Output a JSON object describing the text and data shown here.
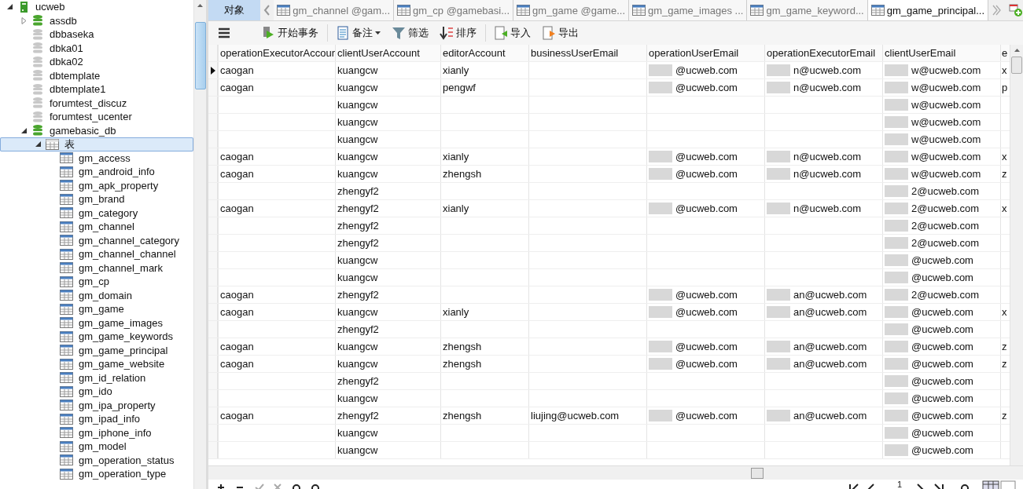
{
  "sidebar": {
    "tree": [
      {
        "label": "ucweb",
        "kind": "connection",
        "selected": false,
        "expanded": true,
        "children": [
          {
            "label": "assdb",
            "kind": "database",
            "open": true,
            "selected": false,
            "expanded": false
          },
          {
            "label": "dbbaseka",
            "kind": "database",
            "open": false,
            "selected": false
          },
          {
            "label": "dbka01",
            "kind": "database",
            "open": false,
            "selected": false
          },
          {
            "label": "dbka02",
            "kind": "database",
            "open": false,
            "selected": false
          },
          {
            "label": "dbtemplate",
            "kind": "database",
            "open": false,
            "selected": false
          },
          {
            "label": "dbtemplate1",
            "kind": "database",
            "open": false,
            "selected": false
          },
          {
            "label": "forumtest_discuz",
            "kind": "database",
            "open": false,
            "selected": false
          },
          {
            "label": "forumtest_ucenter",
            "kind": "database",
            "open": false,
            "selected": false
          },
          {
            "label": "gamebasic_db",
            "kind": "database",
            "open": true,
            "selected": false,
            "expanded": true,
            "children": [
              {
                "label": "表",
                "kind": "folder",
                "selected": true,
                "expanded": true,
                "children": [
                  {
                    "label": "gm_access",
                    "kind": "table",
                    "selected": false
                  },
                  {
                    "label": "gm_android_info",
                    "kind": "table",
                    "selected": false
                  },
                  {
                    "label": "gm_apk_property",
                    "kind": "table",
                    "selected": false
                  },
                  {
                    "label": "gm_brand",
                    "kind": "table",
                    "selected": false
                  },
                  {
                    "label": "gm_category",
                    "kind": "table",
                    "selected": false
                  },
                  {
                    "label": "gm_channel",
                    "kind": "table",
                    "selected": false
                  },
                  {
                    "label": "gm_channel_category",
                    "kind": "table",
                    "selected": false
                  },
                  {
                    "label": "gm_channel_channel",
                    "kind": "table",
                    "selected": false
                  },
                  {
                    "label": "gm_channel_mark",
                    "kind": "table",
                    "selected": false
                  },
                  {
                    "label": "gm_cp",
                    "kind": "table",
                    "selected": false
                  },
                  {
                    "label": "gm_domain",
                    "kind": "table",
                    "selected": false
                  },
                  {
                    "label": "gm_game",
                    "kind": "table",
                    "selected": false
                  },
                  {
                    "label": "gm_game_images",
                    "kind": "table",
                    "selected": false
                  },
                  {
                    "label": "gm_game_keywords",
                    "kind": "table",
                    "selected": false
                  },
                  {
                    "label": "gm_game_principal",
                    "kind": "table",
                    "selected": false
                  },
                  {
                    "label": "gm_game_website",
                    "kind": "table",
                    "selected": false
                  },
                  {
                    "label": "gm_id_relation",
                    "kind": "table",
                    "selected": false
                  },
                  {
                    "label": "gm_ido",
                    "kind": "table",
                    "selected": false
                  },
                  {
                    "label": "gm_ipa_property",
                    "kind": "table",
                    "selected": false
                  },
                  {
                    "label": "gm_ipad_info",
                    "kind": "table",
                    "selected": false
                  },
                  {
                    "label": "gm_iphone_info",
                    "kind": "table",
                    "selected": false
                  },
                  {
                    "label": "gm_model",
                    "kind": "table",
                    "selected": false
                  },
                  {
                    "label": "gm_operation_status",
                    "kind": "table",
                    "selected": false
                  },
                  {
                    "label": "gm_operation_type",
                    "kind": "table",
                    "selected": false
                  }
                ]
              }
            ]
          }
        ]
      }
    ]
  },
  "objects_tab": {
    "label": "对象"
  },
  "tabs": [
    {
      "label": "gm_channel @gam...",
      "selected": false
    },
    {
      "label": "gm_cp @gamebasi...",
      "selected": false
    },
    {
      "label": "gm_game @game...",
      "selected": false
    },
    {
      "label": "gm_game_images ...",
      "selected": false
    },
    {
      "label": "gm_game_keyword...",
      "selected": false
    },
    {
      "label": "gm_game_principal...",
      "selected": true
    }
  ],
  "toolbar": [
    {
      "kind": "menu"
    },
    {
      "kind": "transaction",
      "label": "开始事务"
    },
    {
      "kind": "note",
      "label": "备注"
    },
    {
      "kind": "filter",
      "label": "筛选"
    },
    {
      "kind": "sort",
      "label": "排序"
    },
    {
      "kind": "import",
      "label": "导入"
    },
    {
      "kind": "export",
      "label": "导出"
    }
  ],
  "table": {
    "columns": [
      {
        "label": "operationExecutorAccour",
        "redacted": false
      },
      {
        "label": "clientUserAccount",
        "redacted": false
      },
      {
        "label": "editorAccount",
        "redacted": false
      },
      {
        "label": "businessUserEmail",
        "redacted": false
      },
      {
        "label": "operationUserEmail",
        "redacted": true
      },
      {
        "label": "operationExecutorEmail",
        "redacted": true
      },
      {
        "label": "clientUserEmail",
        "redacted": true
      },
      {
        "label": "e",
        "redacted": false
      }
    ],
    "rows": [
      {
        "selected": true,
        "cells": [
          "caogan",
          "kuangcw",
          "xianly",
          "",
          "@ucweb.com",
          "n@ucweb.com",
          "w@ucweb.com",
          "x"
        ]
      },
      {
        "selected": false,
        "cells": [
          "caogan",
          "kuangcw",
          "pengwf",
          "",
          "@ucweb.com",
          "n@ucweb.com",
          "w@ucweb.com",
          "p"
        ]
      },
      {
        "selected": false,
        "cells": [
          "",
          "kuangcw",
          "",
          "",
          "",
          "",
          "w@ucweb.com",
          ""
        ]
      },
      {
        "selected": false,
        "cells": [
          "",
          "kuangcw",
          "",
          "",
          "",
          "",
          "w@ucweb.com",
          ""
        ]
      },
      {
        "selected": false,
        "cells": [
          "",
          "kuangcw",
          "",
          "",
          "",
          "",
          "w@ucweb.com",
          ""
        ]
      },
      {
        "selected": false,
        "cells": [
          "caogan",
          "kuangcw",
          "xianly",
          "",
          "@ucweb.com",
          "n@ucweb.com",
          "w@ucweb.com",
          "x"
        ]
      },
      {
        "selected": false,
        "cells": [
          "caogan",
          "kuangcw",
          "zhengsh",
          "",
          "@ucweb.com",
          "n@ucweb.com",
          "w@ucweb.com",
          "z"
        ]
      },
      {
        "selected": false,
        "cells": [
          "",
          "zhengyf2",
          "",
          "",
          "",
          "",
          "2@ucweb.com",
          ""
        ]
      },
      {
        "selected": false,
        "cells": [
          "caogan",
          "zhengyf2",
          "xianly",
          "",
          "@ucweb.com",
          "n@ucweb.com",
          "2@ucweb.com",
          "x"
        ]
      },
      {
        "selected": false,
        "cells": [
          "",
          "zhengyf2",
          "",
          "",
          "",
          "",
          "2@ucweb.com",
          ""
        ]
      },
      {
        "selected": false,
        "cells": [
          "",
          "zhengyf2",
          "",
          "",
          "",
          "",
          "2@ucweb.com",
          ""
        ]
      },
      {
        "selected": false,
        "cells": [
          "",
          "kuangcw",
          "",
          "",
          "",
          "",
          "@ucweb.com",
          ""
        ]
      },
      {
        "selected": false,
        "cells": [
          "",
          "kuangcw",
          "",
          "",
          "",
          "",
          "@ucweb.com",
          ""
        ]
      },
      {
        "selected": false,
        "cells": [
          "caogan",
          "zhengyf2",
          "",
          "",
          "@ucweb.com",
          "an@ucweb.com",
          "2@ucweb.com",
          ""
        ]
      },
      {
        "selected": false,
        "cells": [
          "caogan",
          "kuangcw",
          "xianly",
          "",
          "@ucweb.com",
          "an@ucweb.com",
          "@ucweb.com",
          "x"
        ]
      },
      {
        "selected": false,
        "cells": [
          "",
          "zhengyf2",
          "",
          "",
          "",
          "",
          "@ucweb.com",
          ""
        ]
      },
      {
        "selected": false,
        "cells": [
          "caogan",
          "kuangcw",
          "zhengsh",
          "",
          "@ucweb.com",
          "an@ucweb.com",
          "@ucweb.com",
          "z"
        ]
      },
      {
        "selected": false,
        "cells": [
          "caogan",
          "kuangcw",
          "zhengsh",
          "",
          "@ucweb.com",
          "an@ucweb.com",
          "@ucweb.com",
          "z"
        ]
      },
      {
        "selected": false,
        "cells": [
          "",
          "zhengyf2",
          "",
          "",
          "",
          "",
          "@ucweb.com",
          ""
        ]
      },
      {
        "selected": false,
        "cells": [
          "",
          "kuangcw",
          "",
          "",
          "",
          "",
          "@ucweb.com",
          ""
        ]
      },
      {
        "selected": false,
        "cells": [
          "caogan",
          "zhengyf2",
          "zhengsh",
          "liujing@ucweb.com",
          "@ucweb.com",
          "an@ucweb.com",
          "@ucweb.com",
          "z"
        ]
      },
      {
        "selected": false,
        "cells": [
          "",
          "kuangcw",
          "",
          "",
          "",
          "",
          "@ucweb.com",
          ""
        ]
      },
      {
        "selected": false,
        "cells": [
          "",
          "kuangcw",
          "",
          "",
          "",
          "",
          "@ucweb.com",
          ""
        ]
      }
    ]
  },
  "pager": {
    "page": "1"
  }
}
